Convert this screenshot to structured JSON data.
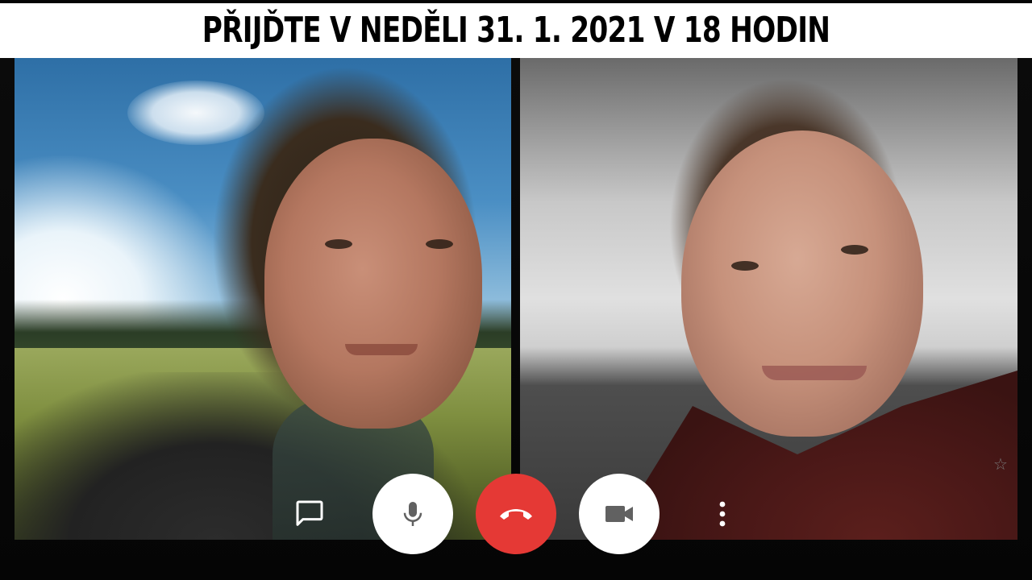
{
  "banner": {
    "text": "PŘIJĎTE V NEDĚLI 31. 1. 2021  V 18 HODIN"
  },
  "participants": [
    {
      "position": "left"
    },
    {
      "position": "right"
    }
  ],
  "controls": {
    "chat_icon": "chat-bubble-icon",
    "mic_icon": "microphone-icon",
    "end_call_icon": "phone-hangup-icon",
    "camera_icon": "videocam-icon",
    "more_icon": "more-vertical-icon",
    "star_icon": "star-outline-icon"
  },
  "colors": {
    "end_call": "#e53935",
    "control_bg": "#ffffff",
    "icon_gray": "#616161",
    "banner_bg": "#ffffff",
    "banner_text": "#000000"
  }
}
